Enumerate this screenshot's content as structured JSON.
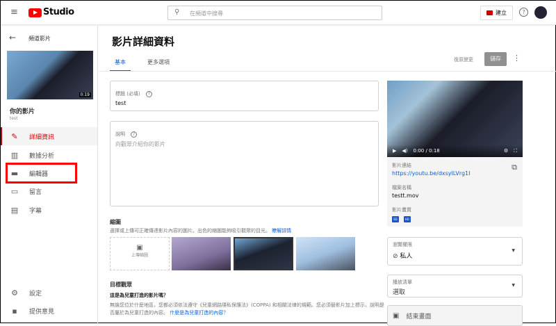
{
  "topbar": {
    "logo_text": "Studio",
    "search_placeholder": "在頻道中搜尋",
    "create_label": "建立"
  },
  "sidebar": {
    "back_label": "頻道影片",
    "video_duration": "0:19",
    "your_video_label": "你的影片",
    "video_title": "test",
    "items": [
      {
        "label": "詳細資訊",
        "icon": "pencil-icon",
        "active": true
      },
      {
        "label": "數據分析",
        "icon": "analytics-icon"
      },
      {
        "label": "編輯器",
        "icon": "editor-icon",
        "highlighted": true
      },
      {
        "label": "留言",
        "icon": "comments-icon"
      },
      {
        "label": "字幕",
        "icon": "subtitles-icon"
      }
    ],
    "bottom_items": [
      {
        "label": "設定",
        "icon": "gear-icon"
      },
      {
        "label": "提供意見",
        "icon": "feedback-icon"
      }
    ]
  },
  "main": {
    "page_title": "影片詳細資料",
    "tabs": [
      {
        "label": "基本",
        "active": true
      },
      {
        "label": "更多選項"
      }
    ],
    "undo_label": "復原變更",
    "save_label": "儲存",
    "title_field": {
      "label": "標題 (必填)",
      "value": "test"
    },
    "description_field": {
      "label": "說明",
      "placeholder": "向觀眾介紹你的影片"
    },
    "thumbnail": {
      "heading": "縮圖",
      "desc": "選擇或上傳可正確傳達影片內容的圖片。出色的縮圖能夠吸引觀眾的目光。",
      "learn_more": "瞭解詳情",
      "upload_label": "上傳縮圖"
    },
    "audience": {
      "heading": "目標觀眾",
      "question": "這是為兒童打造的影片嗎？",
      "desc": "無論您位於什麼地區，您都必須依法遵守《兒童網路隱私保護法》(COPPA) 和相關法律的規範。您必須替影片加上標示，說明是否屬於為兒童打造的內容。",
      "link": "什麼是為兒童打造的內容？"
    }
  },
  "panel": {
    "time": "0:00 / 0:18",
    "link_label": "影片連結",
    "link": "https://youtu.be/dxsylLVrg1I",
    "filename_label": "檔案名稱",
    "filename": "testt.mov",
    "quality_label": "影片畫質",
    "quality_badges": [
      "SD",
      "HD"
    ],
    "visibility_label": "瀏覽權限",
    "visibility_value": "私人",
    "playlist_label": "播放清單",
    "playlist_value": "選取",
    "end_screen_label": "結束畫面"
  },
  "colors": {
    "accent": "#065fd4",
    "red": "#cc0000",
    "highlight_box": "#ff0000"
  }
}
